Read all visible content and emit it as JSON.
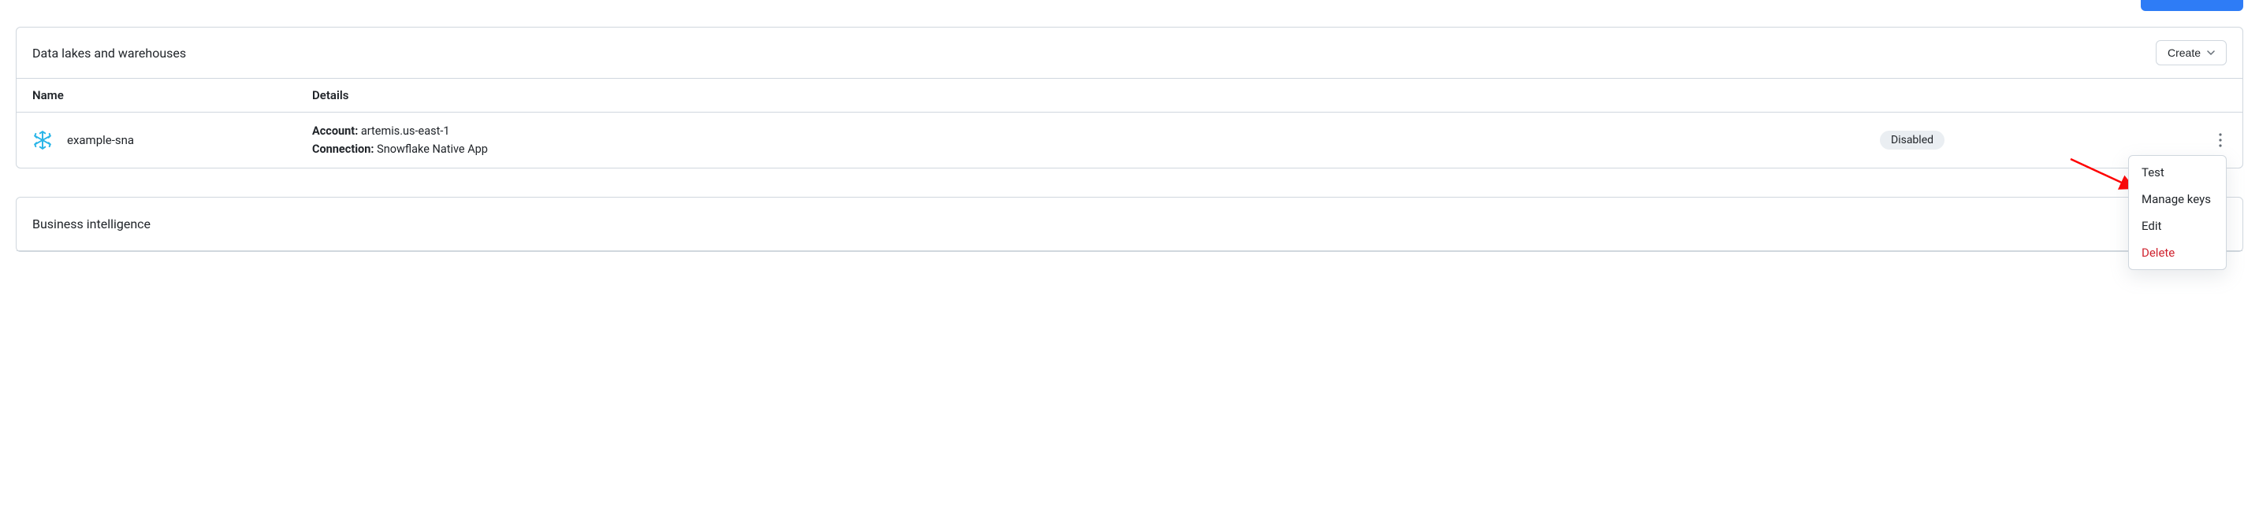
{
  "topButton": {},
  "section1": {
    "title": "Data lakes and warehouses",
    "createButton": "Create",
    "columns": {
      "name": "Name",
      "details": "Details"
    },
    "rows": [
      {
        "name": "example-sna",
        "accountLabel": "Account:",
        "accountValue": "artemis.us-east-1",
        "connectionLabel": "Connection:",
        "connectionValue": "Snowflake Native App",
        "status": "Disabled"
      }
    ]
  },
  "section2": {
    "title": "Business intelligence"
  },
  "dropdown": {
    "test": "Test",
    "manageKeys": "Manage keys",
    "edit": "Edit",
    "delete": "Delete"
  }
}
